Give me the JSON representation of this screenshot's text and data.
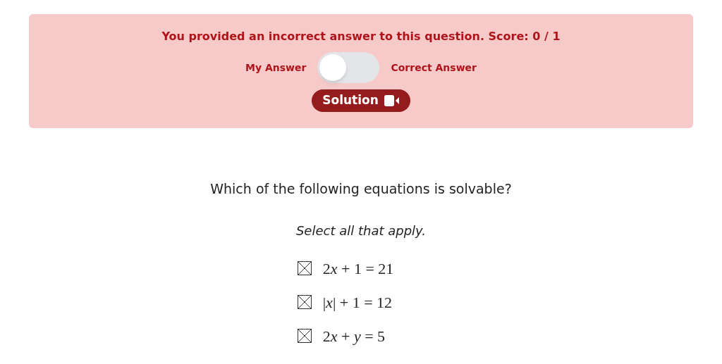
{
  "feedback": {
    "message": "You provided an incorrect answer to this question. Score: 0 / 1",
    "toggle": {
      "left_label": "My Answer",
      "right_label": "Correct Answer",
      "on": false
    },
    "solution_button": "Solution"
  },
  "question": {
    "text": "Which of the following equations is solvable?",
    "instruction": "Select all that apply.",
    "options": [
      {
        "checked": true,
        "parts": [
          {
            "text": "2",
            "italic": false
          },
          {
            "text": "x",
            "italic": true
          },
          {
            "text": " + 1 = 21",
            "italic": false
          }
        ]
      },
      {
        "checked": true,
        "parts": [
          {
            "text": "|",
            "italic": false
          },
          {
            "text": "x",
            "italic": true
          },
          {
            "text": "| + 1 = 12",
            "italic": false
          }
        ]
      },
      {
        "checked": true,
        "parts": [
          {
            "text": "2",
            "italic": false
          },
          {
            "text": "x",
            "italic": true
          },
          {
            "text": " + ",
            "italic": false
          },
          {
            "text": "y",
            "italic": true
          },
          {
            "text": " = 5",
            "italic": false
          }
        ]
      }
    ]
  }
}
